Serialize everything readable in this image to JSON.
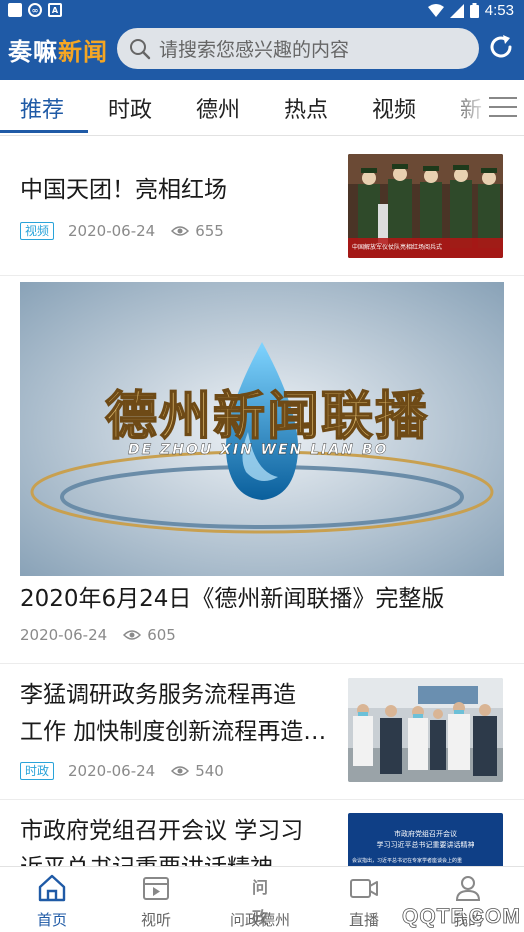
{
  "status_bar": {
    "time": "4:53"
  },
  "header": {
    "logo_main": "奏嘛",
    "logo_accent": "新闻",
    "search_placeholder": "请搜索您感兴趣的内容"
  },
  "tabs": [
    {
      "label": "推荐",
      "active": true
    },
    {
      "label": "时政"
    },
    {
      "label": "德州"
    },
    {
      "label": "热点"
    },
    {
      "label": "视频"
    },
    {
      "label": "新"
    }
  ],
  "feed": [
    {
      "title": "中国天团！亮相红场",
      "tag": "视频",
      "date": "2020-06-24",
      "views": "655",
      "thumb_caption": "中国解放军仪仗队亮相红场阅兵式"
    },
    {
      "title": "2020年6月24日《德州新闻联播》完整版",
      "date": "2020-06-24",
      "views": "605",
      "banner_cn": "德州新闻联播",
      "banner_py": "DE ZHOU XIN WEN LIAN BO"
    },
    {
      "title_line1": "李猛调研政务服务流程再造",
      "title_line2": "工作 加快制度创新流程再造…",
      "tag": "时政",
      "date": "2020-06-24",
      "views": "540"
    },
    {
      "title_line1": "市政府党组召开会议 学习习",
      "title_line2": "近平总书记重要讲话精神",
      "thumb_line1": "市政府党组召开会议",
      "thumb_line2": "学习习近平总书记重要讲话精神",
      "thumb_line3": "会议指出，习近平总书记在专家学者座谈会上的重"
    }
  ],
  "bottom_nav": [
    {
      "label": "首页",
      "active": true,
      "icon": "home-icon"
    },
    {
      "label": "视听",
      "icon": "film-icon"
    },
    {
      "label": "问政德州",
      "icon": "wenzheng-icon",
      "icon_text": "问政"
    },
    {
      "label": "直播",
      "icon": "video-camera-icon"
    },
    {
      "label": "我的",
      "icon": "user-icon"
    }
  ],
  "watermark": "QQTF.COM",
  "colors": {
    "brand_blue": "#1f5aa6",
    "accent_orange": "#f5a623",
    "tag_blue": "#29a3d9"
  }
}
